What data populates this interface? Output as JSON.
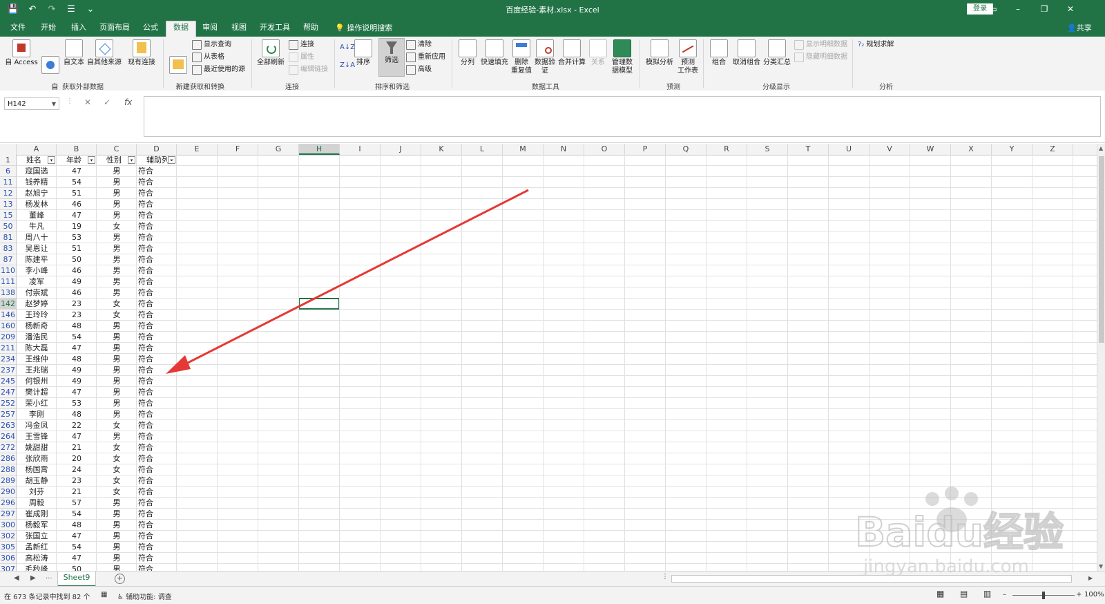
{
  "window": {
    "title": "百度经验-素材.xlsx  -  Excel",
    "login_label": "登录",
    "minimize": "–",
    "restore": "❐",
    "close": "✕",
    "ribbon_display": "▭"
  },
  "qat": {
    "save": "💾",
    "undo": "↶",
    "redo": "↷",
    "touch": "☰",
    "more": "⌄"
  },
  "tabs": [
    "文件",
    "开始",
    "插入",
    "页面布局",
    "公式",
    "数据",
    "审阅",
    "视图",
    "开发工具",
    "帮助"
  ],
  "active_tab": "数据",
  "tell_me": "操作说明搜索",
  "share": "共享",
  "ribbon": {
    "ext_group": "获取外部数据",
    "ext_buttons": [
      "自 Access",
      "自\nWeb",
      "自文本",
      "自其他来源",
      "现有连接"
    ],
    "get_transform_group": "获取和转换",
    "new_query": "新建\n查询",
    "show_queries": "显示查询",
    "from_table": "从表格",
    "recent_sources": "最近使用的源",
    "connections_group": "连接",
    "refresh_all": "全部刷新",
    "connections": "连接",
    "properties": "属性",
    "edit_links": "编辑链接",
    "sort_filter_group": "排序和筛选",
    "sort_az": "A↓Z",
    "sort_za": "Z↓A",
    "sort": "排序",
    "filter": "筛选",
    "clear": "清除",
    "reapply": "重新应用",
    "advanced": "高级",
    "data_tools_group": "数据工具",
    "data_tools": [
      "分列",
      "快速填充",
      "删除\n重复值",
      "数据验\n证",
      "合并计算",
      "关系",
      "管理数\n据模型"
    ],
    "forecast_group": "预测",
    "what_if": "模拟分析",
    "forecast_sheet": "预测\n工作表",
    "outline_group": "分级显示",
    "group": "组合",
    "ungroup": "取消组合",
    "subtotal": "分类汇总",
    "show_detail": "显示明细数据",
    "hide_detail": "隐藏明细数据",
    "analysis_group": "分析",
    "solver": "规划求解"
  },
  "formula_bar": {
    "name_box": "H142",
    "cancel": "✕",
    "enter": "✓",
    "fx": "fx",
    "formula": ""
  },
  "columns": [
    "A",
    "B",
    "C",
    "D",
    "E",
    "F",
    "G",
    "H",
    "I",
    "J",
    "K",
    "L",
    "M",
    "N",
    "O",
    "P",
    "Q",
    "R",
    "S",
    "T",
    "U",
    "V",
    "W",
    "X",
    "Y",
    "Z"
  ],
  "selected_column": "H",
  "selected_row": "142",
  "header_row": {
    "row": "1",
    "cells": [
      "姓名",
      "年龄",
      "性别",
      "辅助列"
    ]
  },
  "rows": [
    {
      "r": "6",
      "name": "寇国选",
      "age": "47",
      "sex": "男",
      "aux": "符合"
    },
    {
      "r": "11",
      "name": "钱养精",
      "age": "54",
      "sex": "男",
      "aux": "符合"
    },
    {
      "r": "12",
      "name": "赵旭宁",
      "age": "51",
      "sex": "男",
      "aux": "符合"
    },
    {
      "r": "13",
      "name": "杨发林",
      "age": "46",
      "sex": "男",
      "aux": "符合"
    },
    {
      "r": "15",
      "name": "董峰",
      "age": "47",
      "sex": "男",
      "aux": "符合"
    },
    {
      "r": "50",
      "name": "牛凡",
      "age": "19",
      "sex": "女",
      "aux": "符合"
    },
    {
      "r": "81",
      "name": "周八十",
      "age": "53",
      "sex": "男",
      "aux": "符合"
    },
    {
      "r": "83",
      "name": "吴恩让",
      "age": "51",
      "sex": "男",
      "aux": "符合"
    },
    {
      "r": "87",
      "name": "陈建平",
      "age": "50",
      "sex": "男",
      "aux": "符合"
    },
    {
      "r": "110",
      "name": "李小峰",
      "age": "46",
      "sex": "男",
      "aux": "符合"
    },
    {
      "r": "111",
      "name": "凌军",
      "age": "49",
      "sex": "男",
      "aux": "符合"
    },
    {
      "r": "138",
      "name": "付崇斌",
      "age": "46",
      "sex": "男",
      "aux": "符合"
    },
    {
      "r": "142",
      "name": "赵梦婷",
      "age": "23",
      "sex": "女",
      "aux": "符合"
    },
    {
      "r": "146",
      "name": "王玲玲",
      "age": "23",
      "sex": "女",
      "aux": "符合"
    },
    {
      "r": "160",
      "name": "杨新奇",
      "age": "48",
      "sex": "男",
      "aux": "符合"
    },
    {
      "r": "209",
      "name": "潘浩民",
      "age": "54",
      "sex": "男",
      "aux": "符合"
    },
    {
      "r": "211",
      "name": "陈大磊",
      "age": "47",
      "sex": "男",
      "aux": "符合"
    },
    {
      "r": "234",
      "name": "王维仲",
      "age": "48",
      "sex": "男",
      "aux": "符合"
    },
    {
      "r": "237",
      "name": "王兆瑞",
      "age": "49",
      "sex": "男",
      "aux": "符合"
    },
    {
      "r": "245",
      "name": "何银州",
      "age": "49",
      "sex": "男",
      "aux": "符合"
    },
    {
      "r": "247",
      "name": "樊计超",
      "age": "47",
      "sex": "男",
      "aux": "符合"
    },
    {
      "r": "252",
      "name": "荣小红",
      "age": "53",
      "sex": "男",
      "aux": "符合"
    },
    {
      "r": "257",
      "name": "李刚",
      "age": "48",
      "sex": "男",
      "aux": "符合"
    },
    {
      "r": "263",
      "name": "冯金凤",
      "age": "22",
      "sex": "女",
      "aux": "符合"
    },
    {
      "r": "264",
      "name": "王雪锋",
      "age": "47",
      "sex": "男",
      "aux": "符合"
    },
    {
      "r": "272",
      "name": "姚甜甜",
      "age": "21",
      "sex": "女",
      "aux": "符合"
    },
    {
      "r": "286",
      "name": "张欣雨",
      "age": "20",
      "sex": "女",
      "aux": "符合"
    },
    {
      "r": "288",
      "name": "杨国霄",
      "age": "24",
      "sex": "女",
      "aux": "符合"
    },
    {
      "r": "289",
      "name": "胡玉静",
      "age": "23",
      "sex": "女",
      "aux": "符合"
    },
    {
      "r": "290",
      "name": "刘芬",
      "age": "21",
      "sex": "女",
      "aux": "符合"
    },
    {
      "r": "296",
      "name": "周毅",
      "age": "57",
      "sex": "男",
      "aux": "符合"
    },
    {
      "r": "297",
      "name": "崔成刚",
      "age": "54",
      "sex": "男",
      "aux": "符合"
    },
    {
      "r": "300",
      "name": "杨毅军",
      "age": "48",
      "sex": "男",
      "aux": "符合"
    },
    {
      "r": "302",
      "name": "张国立",
      "age": "47",
      "sex": "男",
      "aux": "符合"
    },
    {
      "r": "305",
      "name": "孟新红",
      "age": "54",
      "sex": "男",
      "aux": "符合"
    },
    {
      "r": "306",
      "name": "高松涛",
      "age": "47",
      "sex": "男",
      "aux": "符合"
    },
    {
      "r": "307",
      "name": "毛秒峰",
      "age": "50",
      "sex": "男",
      "aux": "符合"
    }
  ],
  "sheet_tabs": {
    "nav_prev": "◀",
    "nav_next": "▶",
    "ellipsis": "...",
    "active": "Sheet9",
    "add": "+"
  },
  "status": {
    "records": "在 673 条记录中找到 82 个",
    "accessibility": "辅助功能: 调查",
    "zoom": "100%",
    "zoom_minus": "–",
    "zoom_plus": "+"
  },
  "watermark": {
    "brand": "Baidu经验",
    "url": "jingyan.baidu.com"
  },
  "colors": {
    "excel_green": "#217346",
    "arrow_red": "#e53935",
    "row_link_blue": "#2a4fb3"
  }
}
